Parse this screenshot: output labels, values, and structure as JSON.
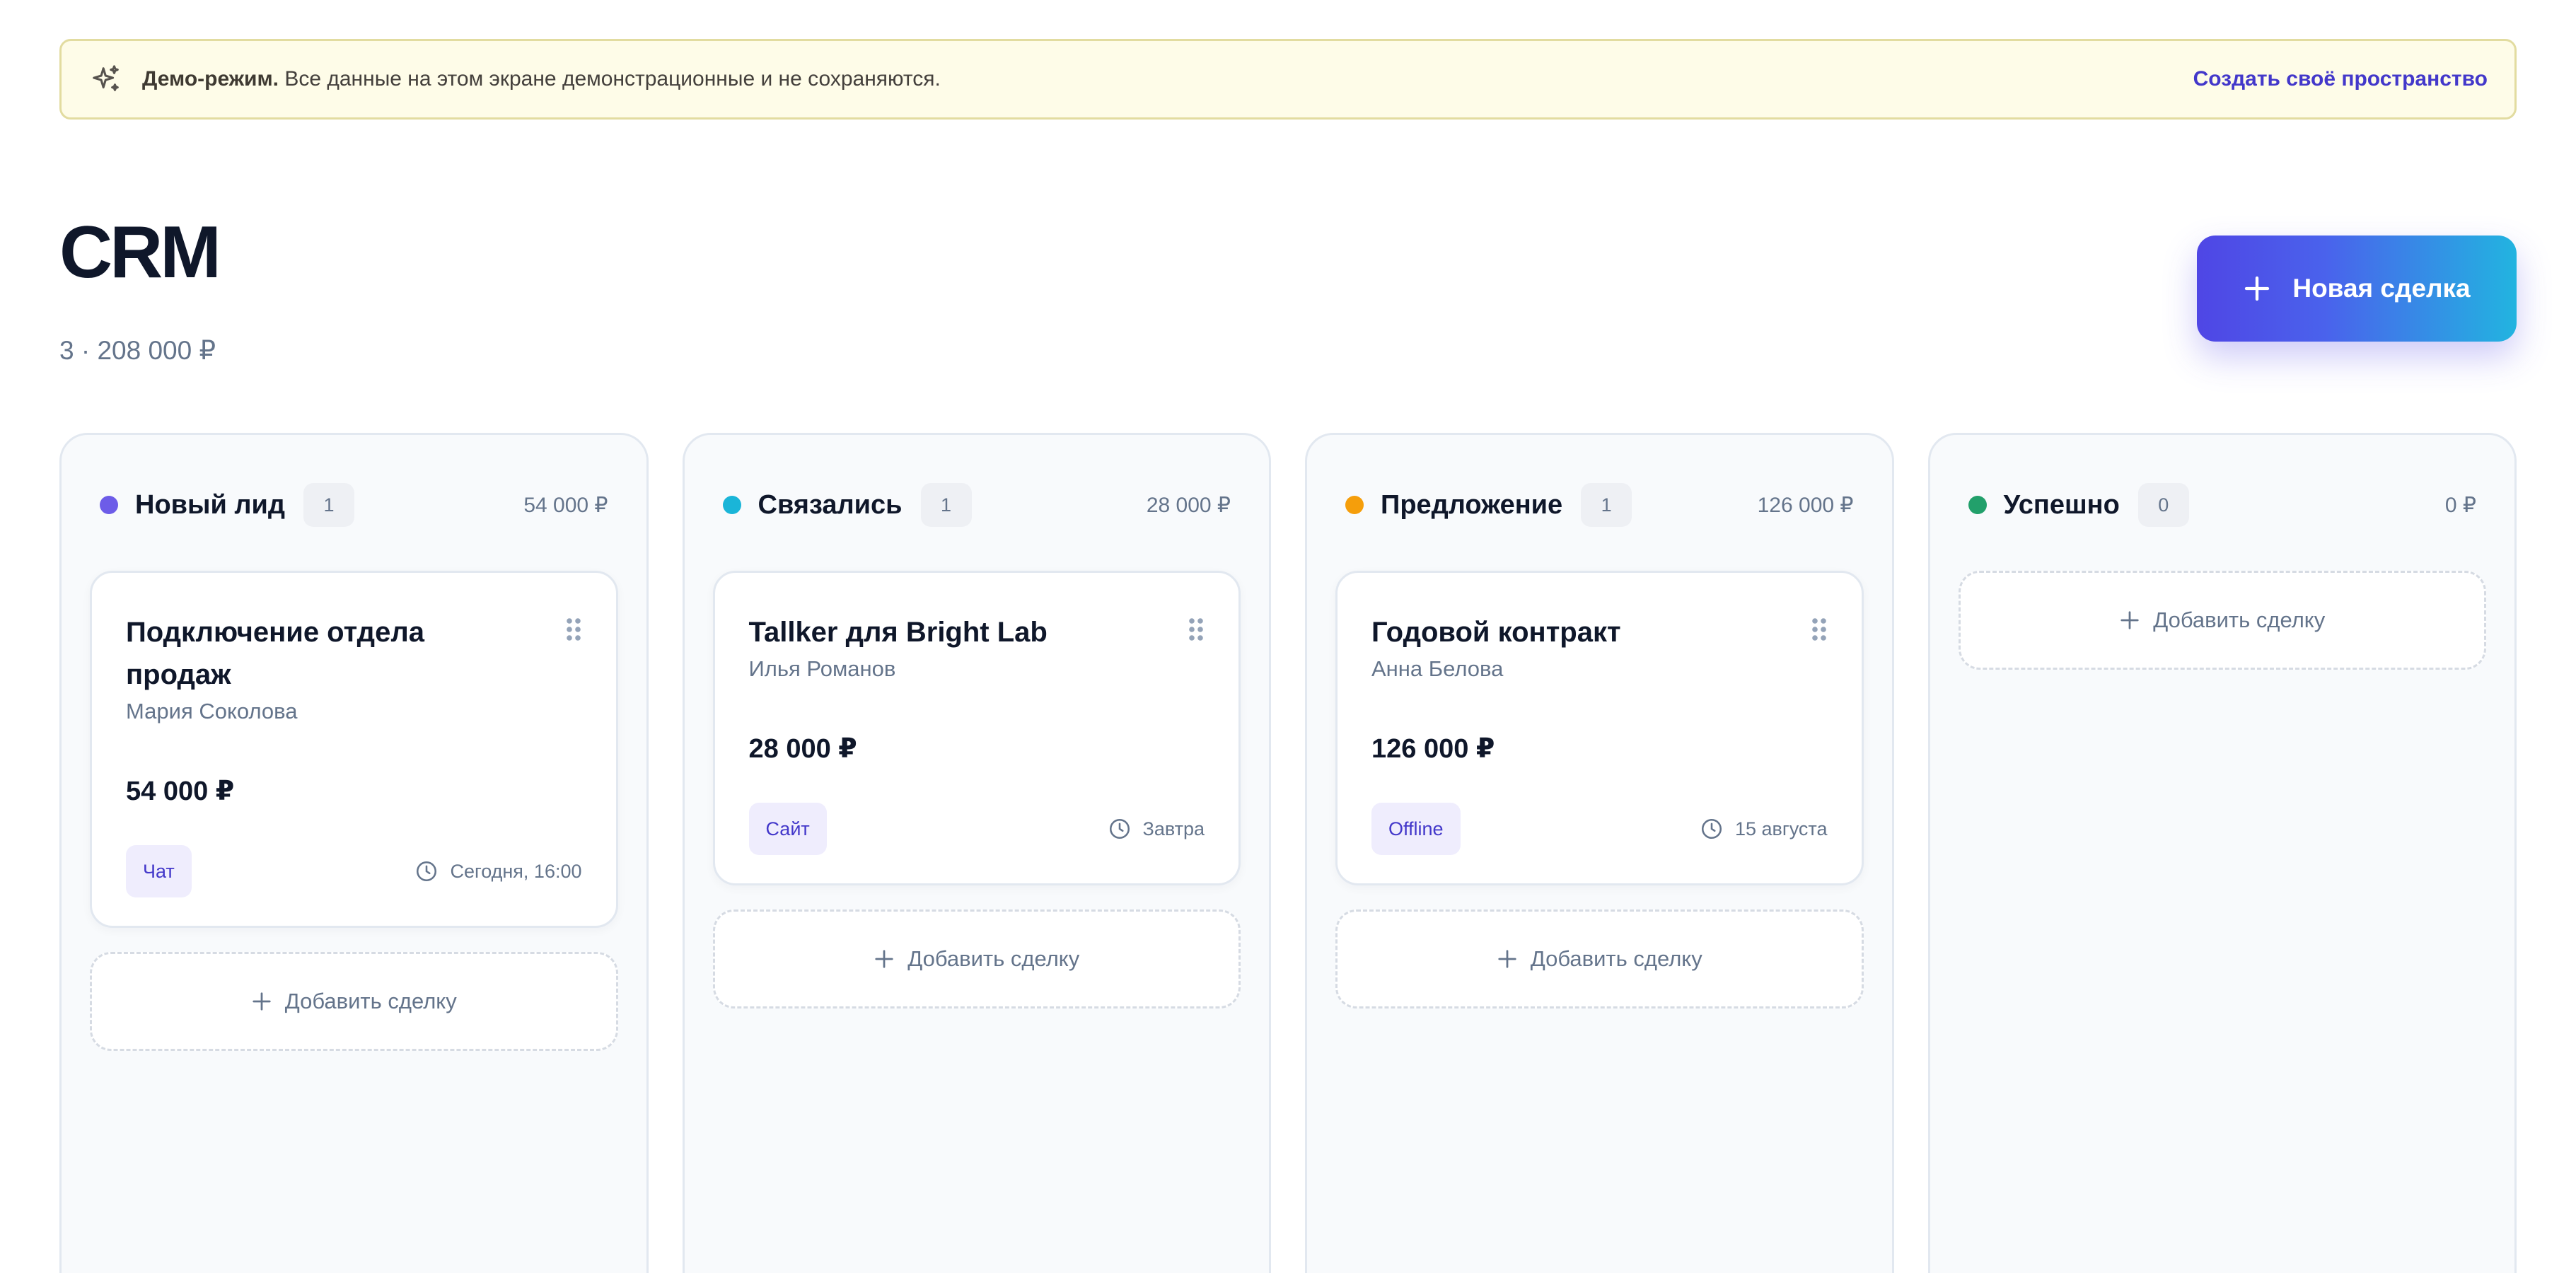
{
  "banner": {
    "icon": "sparkle-icon",
    "bold_text": "Демо-режим.",
    "text": " Все данные на этом экране демонстрационные и не сохраняются.",
    "link_label": "Создать своё пространство"
  },
  "header": {
    "title": "CRM",
    "subtitle": "3 · 208 000 ₽",
    "new_deal_label": "Новая сделка"
  },
  "colors": {
    "accent": "#4f46e5",
    "accent_end": "#22b4e0",
    "new_lead": "#6d5ce8",
    "contacted": "#1ab5d8",
    "proposal": "#f59e0b",
    "success": "#22a06b"
  },
  "columns": [
    {
      "title": "Новый лид",
      "count": "1",
      "sum": "54 000 ₽",
      "color": "#6d5ce8",
      "add_label": "Добавить сделку",
      "cards": [
        {
          "title": "Подключение отдела продаж",
          "person": "Мария Соколова",
          "amount": "54 000 ₽",
          "tag": "Чат",
          "due": "Сегодня, 16:00"
        }
      ]
    },
    {
      "title": "Связались",
      "count": "1",
      "sum": "28 000 ₽",
      "color": "#1ab5d8",
      "add_label": "Добавить сделку",
      "cards": [
        {
          "title": "Tallker для Bright Lab",
          "person": "Илья Романов",
          "amount": "28 000 ₽",
          "tag": "Сайт",
          "due": "Завтра"
        }
      ]
    },
    {
      "title": "Предложение",
      "count": "1",
      "sum": "126 000 ₽",
      "color": "#f59e0b",
      "add_label": "Добавить сделку",
      "cards": [
        {
          "title": "Годовой контракт",
          "person": "Анна Белова",
          "amount": "126 000 ₽",
          "tag": "Offline",
          "due": "15 августа"
        }
      ]
    },
    {
      "title": "Успешно",
      "count": "0",
      "sum": "0 ₽",
      "color": "#22a06b",
      "add_label": "Добавить сделку",
      "cards": []
    }
  ]
}
